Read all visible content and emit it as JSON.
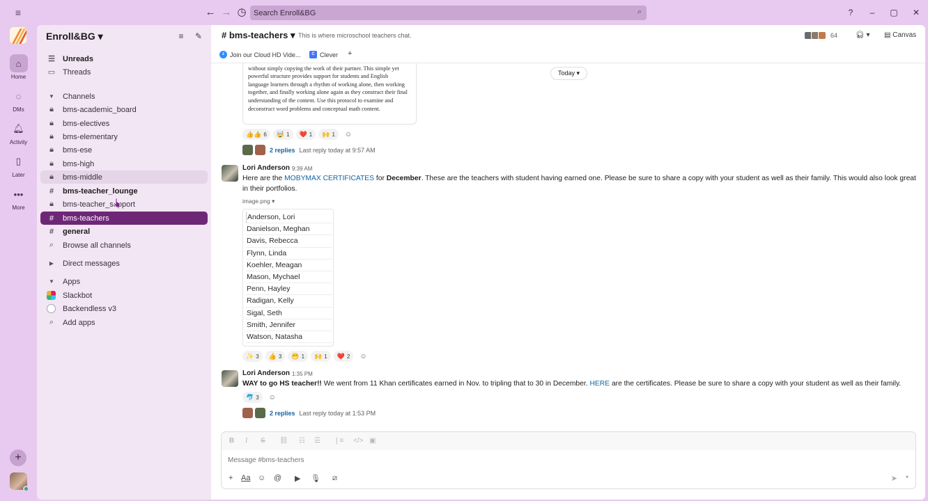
{
  "search": {
    "placeholder": "Search Enroll&BG"
  },
  "rail": {
    "items": [
      {
        "label": "Home"
      },
      {
        "label": "DMs"
      },
      {
        "label": "Activity"
      },
      {
        "label": "Later"
      },
      {
        "label": "More"
      }
    ]
  },
  "sidebar": {
    "workspace": "Enroll&BG",
    "unreads": "Unreads",
    "threads": "Threads",
    "channels_header": "Channels",
    "channels": [
      {
        "name": "bms-academic_board",
        "type": "lock"
      },
      {
        "name": "bms-electives",
        "type": "lock"
      },
      {
        "name": "bms-elementary",
        "type": "lock"
      },
      {
        "name": "bms-ese",
        "type": "lock"
      },
      {
        "name": "bms-high",
        "type": "lock"
      },
      {
        "name": "bms-middle",
        "type": "lock"
      },
      {
        "name": "bms-teacher_lounge",
        "type": "hash"
      },
      {
        "name": "bms-teacher_support",
        "type": "lock"
      },
      {
        "name": "bms-teachers",
        "type": "hash"
      },
      {
        "name": "general",
        "type": "hash"
      },
      {
        "name": "Browse all channels",
        "type": "search"
      }
    ],
    "dm_header": "Direct messages",
    "apps_header": "Apps",
    "apps": [
      {
        "name": "Slackbot"
      },
      {
        "name": "Backendless v3"
      },
      {
        "name": "Add apps"
      }
    ]
  },
  "channel": {
    "title": "# bms-teachers",
    "description": "This is where microschool teachers chat.",
    "member_count": "64",
    "canvas_label": "Canvas",
    "bookmarks": [
      {
        "label": "Join our Cloud HD Vide..."
      },
      {
        "label": "Clever"
      },
      {
        "label": "+"
      }
    ]
  },
  "feed": {
    "today_label": "Today",
    "doc_text": "students compare their understanding of the topic with a partner without simply copying the work of their partner. This simple yet powerful structure provides support for students and English language learners through a rhythm of working alone, then working together, and finally working alone again as they construct their final understanding of the content. Use this protocol to examine and deconstruct word problems and conceptual math content.",
    "first_reactions": [
      {
        "emoji": "👍👍",
        "count": "6"
      },
      {
        "emoji": "🤯",
        "count": "1"
      },
      {
        "emoji": "❤️",
        "count": "1"
      },
      {
        "emoji": "🙌",
        "count": "1"
      }
    ],
    "first_thread": {
      "replies": "2 replies",
      "last": "Last reply today at 9:57 AM"
    },
    "messages": [
      {
        "author": "Lori Anderson",
        "time": "9:39 AM",
        "text_pre": "Here are the ",
        "link": "MOBYMAX CERTIFICATES",
        "text_mid": " for ",
        "bold": "December",
        "text_post": ".  These are the teachers with student having earned one. Please be sure to share a copy with your student as well as their family.  This would also look great in their portfolios.",
        "image_label": "image.png",
        "names": [
          "Anderson, Lori",
          "Danielson, Meghan",
          "Davis, Rebecca",
          "Flynn, Linda",
          "Koehler, Meagan",
          "Mason, Mychael",
          "Penn, Hayley",
          "Radigan, Kelly",
          "Sigal, Seth",
          "Smith, Jennifer",
          "Watson, Natasha"
        ],
        "reactions": [
          {
            "emoji": "✨",
            "count": "3"
          },
          {
            "emoji": "👍",
            "count": "3"
          },
          {
            "emoji": "😁",
            "count": "1"
          },
          {
            "emoji": "🙌",
            "count": "1"
          },
          {
            "emoji": "❤️",
            "count": "2"
          }
        ]
      },
      {
        "author": "Lori Anderson",
        "time": "1:35 PM",
        "bold": "WAY to go HS teacher!!",
        "text_pre": "  We went from 11 Khan certificates earned in Nov. to tripling that to 30 in December. ",
        "link": "HERE",
        "text_post": " are the certificates. Please be sure to share a copy with your student as well as their family.",
        "reactions": [
          {
            "emoji": "🐬",
            "count": "3"
          }
        ],
        "thread": {
          "replies": "2 replies",
          "last": "Last reply today at 1:53 PM"
        }
      }
    ]
  },
  "composer": {
    "placeholder": "Message #bms-teachers"
  },
  "colors": {
    "accent": "#6e2777",
    "link": "#1264a3",
    "chrome": "#e8c9ef"
  }
}
